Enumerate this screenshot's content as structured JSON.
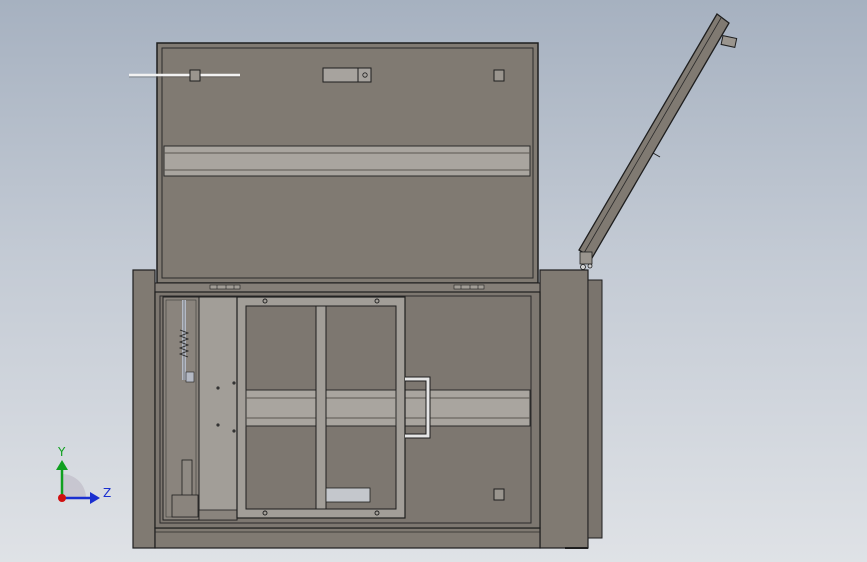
{
  "triad": {
    "y_label": "Y",
    "z_label": "Z",
    "colors": {
      "y": "#10a020",
      "z": "#1a2fd0",
      "x": "#d01010"
    }
  },
  "model": {
    "body_color": "#807a72",
    "panel_color": "#7d7770",
    "band_color": "#a9a59f",
    "edge_color": "#1e1e1e"
  }
}
